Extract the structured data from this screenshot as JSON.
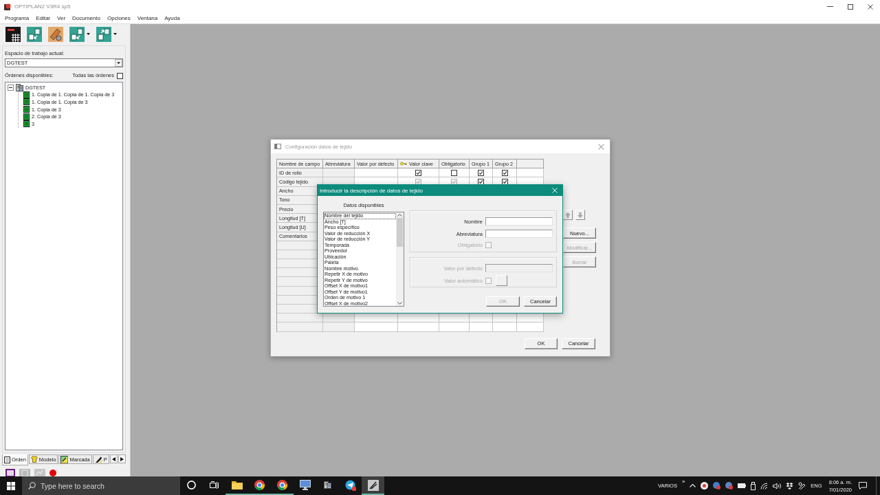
{
  "window": {
    "title": "OPTIPLAN2 V3R4 sp5"
  },
  "menu": [
    "Programa",
    "Editar",
    "Ver",
    "Documento",
    "Opciones",
    "Ventana",
    "Ayuda"
  ],
  "toolbar": [
    {
      "kind": "plain"
    },
    {
      "kind": "plain"
    },
    {
      "kind": "plain"
    },
    {
      "kind": "split"
    },
    {
      "kind": "split"
    }
  ],
  "sidebar": {
    "workspace_label": "Espacio de trabajo actual:",
    "workspace": "DGTEST",
    "orders_label": "Órdenes disponibles:",
    "all_orders": {
      "label": "Todas las órdenes",
      "checked": false
    },
    "tree": [
      {
        "label": "DGTEST",
        "expanded": true,
        "children": [
          {
            "label": "1. Copia de 1. Copia de 1. Copia de 3"
          },
          {
            "label": "1. Copia de 1. Copia de 3"
          },
          {
            "label": "1. Copia de 3"
          },
          {
            "label": "2. Copia de 3"
          },
          {
            "label": "3"
          }
        ]
      }
    ],
    "tabs": [
      {
        "label": "Orden",
        "selected": true
      },
      {
        "label": "Modelo",
        "selected": false
      },
      {
        "label": "Marcada",
        "selected": false
      },
      {
        "label": "P",
        "selected": false
      }
    ]
  },
  "config_dialog": {
    "title": "Configuración datos de tejido",
    "table": {
      "columns": [
        {
          "label": "Nombre de campo",
          "kind": "name"
        },
        {
          "label": "Abreviatura",
          "kind": "fixed"
        },
        {
          "label": "Valor por defecto",
          "kind": "text"
        },
        {
          "label": "Valor clave",
          "kind": "key"
        },
        {
          "label": "Obligatorio",
          "kind": "check"
        },
        {
          "label": "Grupo 1",
          "kind": "check"
        },
        {
          "label": "Grupo 2",
          "kind": "check"
        }
      ],
      "rows": [
        {
          "name": "ID de rollo",
          "checks": [
            {
              "checked": true,
              "disabled": false
            },
            {
              "checked": false,
              "disabled": false
            },
            {
              "checked": true,
              "disabled": false
            },
            {
              "checked": true,
              "disabled": false
            }
          ]
        },
        {
          "name": "Código tejido",
          "checks": [
            {
              "checked": true,
              "disabled": true
            },
            {
              "checked": true,
              "disabled": true
            },
            {
              "checked": true,
              "disabled": false
            },
            {
              "checked": true,
              "disabled": false
            }
          ]
        },
        {
          "name": "Ancho"
        },
        {
          "name": "Tono"
        },
        {
          "name": "Precio"
        },
        {
          "name": "Longitud [T]"
        },
        {
          "name": "Longitud [U]"
        },
        {
          "name": "Comentarios"
        }
      ]
    },
    "move_buttons": [
      {
        "kind": "up",
        "disabled": true
      },
      {
        "kind": "down",
        "disabled": true
      }
    ],
    "side_buttons": [
      {
        "label": "Nuevo...",
        "disabled": false
      },
      {
        "label": "Modificar...",
        "disabled": true
      },
      {
        "label": "Borrar",
        "disabled": true
      }
    ],
    "buttons": [
      "OK",
      "Cancelar"
    ]
  },
  "entry_dialog": {
    "title": "Introducir la descripción de datos de tejido",
    "list_label": "Datos disponibles",
    "list": [
      {
        "label": "Nombre del tejido",
        "selected": true
      },
      {
        "label": "Ancho [T]",
        "selected": false
      },
      {
        "label": "Peso específico",
        "selected": false
      },
      {
        "label": "Valor de reducción X",
        "selected": false
      },
      {
        "label": "Valor de reducción Y",
        "selected": false
      },
      {
        "label": "Temporada",
        "selected": false
      },
      {
        "label": "Proveedor",
        "selected": false
      },
      {
        "label": "Ubicación",
        "selected": false
      },
      {
        "label": "Paleta",
        "selected": false
      },
      {
        "label": "Nombre motivo",
        "selected": false
      },
      {
        "label": "Repetir X de motivo",
        "selected": false
      },
      {
        "label": "Repetir Y de motivo",
        "selected": false
      },
      {
        "label": "Offset X de motivo1",
        "selected": false
      },
      {
        "label": "Offset Y de motivo1",
        "selected": false
      },
      {
        "label": "Orden de motivo 1",
        "selected": false
      },
      {
        "label": "Offset X de motivo2",
        "selected": false
      }
    ],
    "groups": [
      {
        "fields": [
          {
            "kind": "input",
            "label": "Nombre",
            "disabled": false
          },
          {
            "kind": "input",
            "label": "Abreviatura",
            "disabled": false
          },
          {
            "kind": "checkbox",
            "label": "Obligatorio",
            "disabled": true,
            "checked": false
          }
        ]
      },
      {
        "fields": [
          {
            "kind": "input",
            "label": "Valor por defecto",
            "disabled": true
          },
          {
            "kind": "checkbox_button",
            "label": "Valor automático",
            "disabled": true,
            "checked": false
          }
        ]
      }
    ],
    "buttons": [
      {
        "label": "OK",
        "disabled": true
      },
      {
        "label": "Cancelar",
        "disabled": false
      }
    ]
  },
  "taskbar": {
    "search": {
      "placeholder": "Type here to search"
    },
    "apps": [
      {
        "running": true,
        "selected": false
      },
      {
        "running": true,
        "selected": false
      },
      {
        "running": true,
        "selected": false
      },
      {
        "running": false,
        "selected": false
      },
      {
        "running": false,
        "selected": false
      },
      {
        "running": false,
        "selected": false
      },
      {
        "running": true,
        "selected": true
      }
    ],
    "tray": {
      "label": "VARIOS",
      "more": "»",
      "language": "ENG",
      "time": "8:06 a. m.",
      "date": "7/01/2020"
    }
  }
}
